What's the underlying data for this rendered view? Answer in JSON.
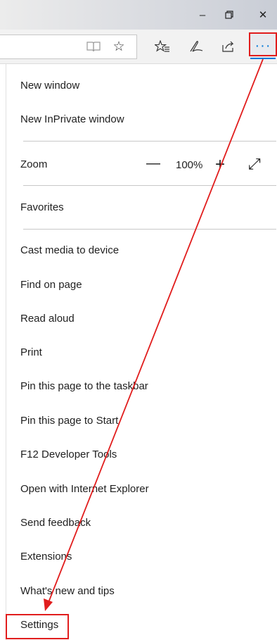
{
  "window": {
    "minimize_icon": "minimize-icon",
    "restore_icon": "restore-icon",
    "close_icon": "close-icon"
  },
  "toolbar": {
    "reading_view_icon": "book-icon",
    "favorite_icon": "star-icon",
    "favorites_hub_icon": "favorites-list-icon",
    "notes_icon": "pen-icon",
    "share_icon": "share-icon",
    "more_icon": "more-icon",
    "more_label": "···"
  },
  "menu": {
    "new_window": "New window",
    "new_inprivate": "New InPrivate window",
    "zoom": {
      "label": "Zoom",
      "minus": "—",
      "value": "100%",
      "plus": "+",
      "fullscreen": "⤢"
    },
    "favorites": "Favorites",
    "cast": "Cast media to device",
    "find": "Find on page",
    "read_aloud": "Read aloud",
    "print": "Print",
    "pin_taskbar": "Pin this page to the taskbar",
    "pin_start": "Pin this page to Start",
    "devtools": "F12 Developer Tools",
    "open_ie": "Open with Internet Explorer",
    "feedback": "Send feedback",
    "extensions": "Extensions",
    "whats_new": "What's new and tips",
    "settings": "Settings"
  },
  "annotation": {
    "color": "#e11d1d"
  },
  "colors": {
    "accent": "#0078d7"
  }
}
